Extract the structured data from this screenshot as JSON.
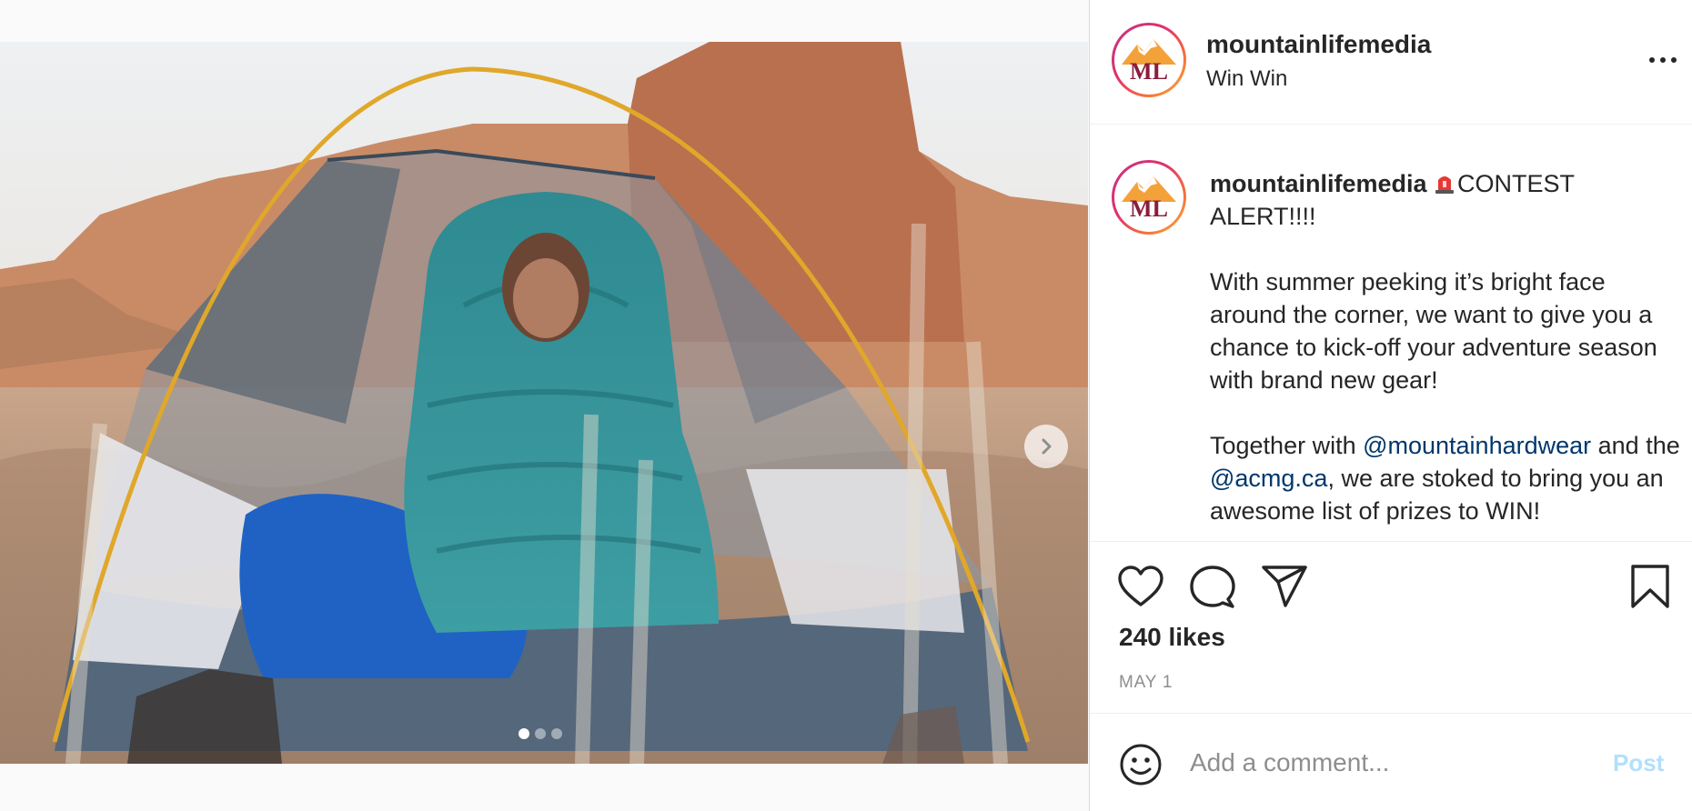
{
  "post": {
    "header": {
      "username": "mountainlifemedia",
      "subtitle": "Win Win",
      "avatar_text": "ML",
      "more_icon": "more-horizontal-icon"
    },
    "caption": {
      "username": "mountainlifemedia",
      "alert_icon": "police-light-emoji",
      "line1": "CONTEST ALERT!!!!",
      "para2": "With summer peeking it’s bright face around the corner, we want to give you a chance to kick-off your adventure season with brand new gear!",
      "para3_before": "Together with ",
      "mention1": "@mountainhardwear",
      "para3_mid": " and the ",
      "mention2": "@acmg.ca",
      "para3_after": ", we are stoked to bring you an awesome list of prizes to WIN!"
    },
    "media": {
      "description_icons": [
        "chevron-right-icon"
      ],
      "carousel_count": 3,
      "carousel_active": 1
    },
    "actions": {
      "like_icon": "heart-icon",
      "comment_icon": "comment-icon",
      "share_icon": "paper-plane-icon",
      "save_icon": "bookmark-icon"
    },
    "likes": "240 likes",
    "date": "MAY 1",
    "comment": {
      "placeholder": "Add a comment...",
      "post_label": "Post",
      "emoji_icon": "smiley-icon"
    }
  },
  "colors": {
    "mention": "#00376b",
    "post_disabled": "#b2dffc",
    "muted": "#8e8e8e",
    "text": "#262626"
  }
}
